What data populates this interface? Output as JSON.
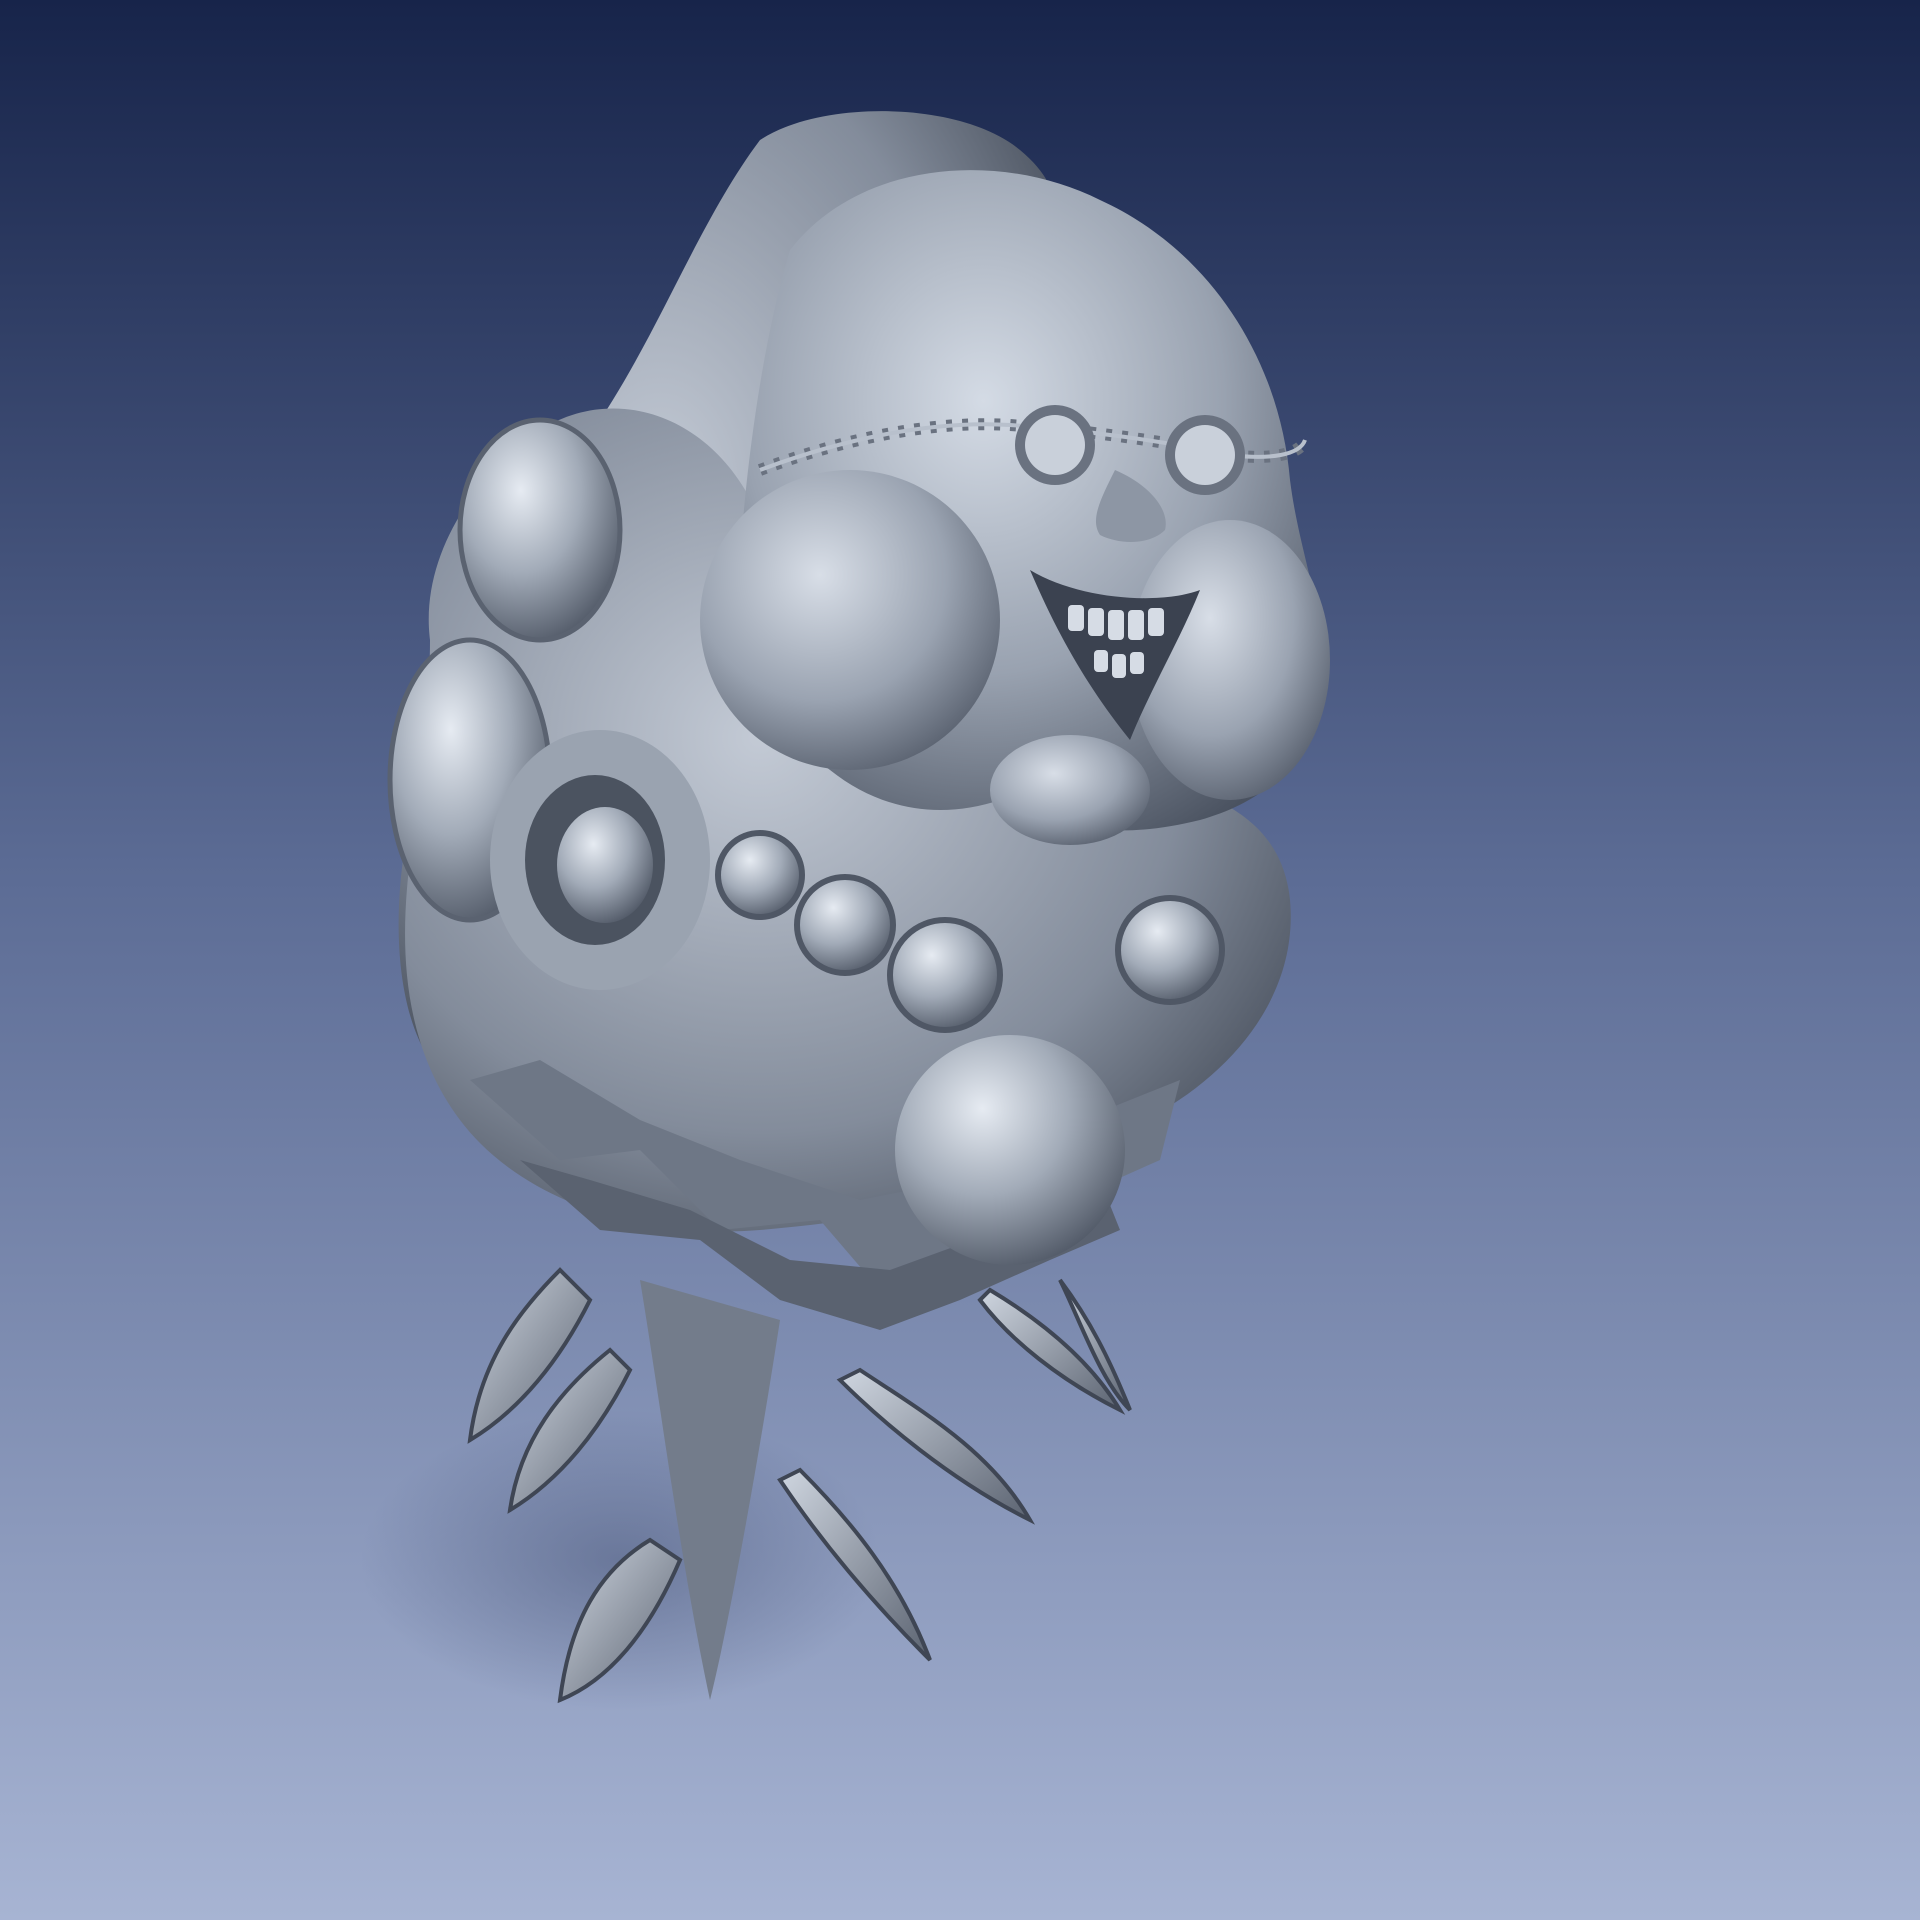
{
  "scene": {
    "background_top": "#17244a",
    "background_mid": "#5b6b94",
    "background_bottom": "#a7b4d3",
    "sculpt_light": "#c8d0dc",
    "sculpt_mid": "#8f98a6",
    "sculpt_dark": "#3d4552",
    "shadow_color": "#4d5a7d"
  }
}
